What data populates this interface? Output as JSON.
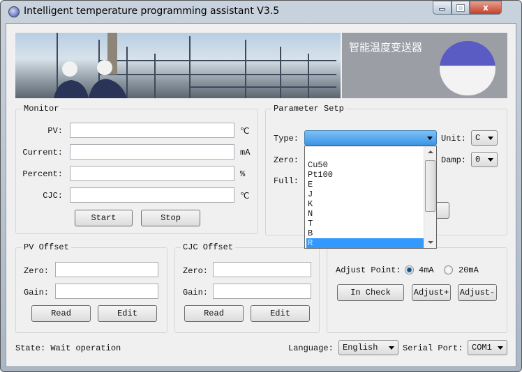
{
  "window": {
    "title": "Intelligent temperature programming assistant V3.5"
  },
  "banner": {
    "chinese_text": "智能温度变送器"
  },
  "monitor": {
    "title": "Monitor",
    "fields": [
      {
        "label": "PV:",
        "value": "",
        "unit": "℃"
      },
      {
        "label": "Current:",
        "value": "",
        "unit": "mA"
      },
      {
        "label": "Percent:",
        "value": "",
        "unit": "%"
      },
      {
        "label": "CJC:",
        "value": "",
        "unit": "℃"
      }
    ],
    "start": "Start",
    "stop": "Stop"
  },
  "parameter": {
    "title": "Parameter Setp",
    "type_label": "Type:",
    "type_value": "",
    "unit_label": "Unit:",
    "unit_value": "C",
    "zero_label": "Zero:",
    "damp_label": "Damp:",
    "damp_value": "0",
    "full_label": "Full:",
    "type_options": [
      "",
      "Cu50",
      "Pt100",
      "E",
      "J",
      "K",
      "N",
      "T",
      "B",
      "R"
    ],
    "selected_option": "R"
  },
  "pv_offset": {
    "title": "PV Offset",
    "zero_label": "Zero:",
    "gain_label": "Gain:",
    "zero": "",
    "gain": "",
    "read": "Read",
    "edit": "Edit"
  },
  "cjc_offset": {
    "title": "CJC Offset",
    "zero_label": "Zero:",
    "gain_label": "Gain:",
    "zero": "",
    "gain": "",
    "read": "Read",
    "edit": "Edit"
  },
  "zero_setup": {
    "adjust_point_label": "Adjust Point:",
    "options": [
      "4mA",
      "20mA"
    ],
    "selected": "4mA",
    "in_check": "In Check",
    "adjust_plus": "Adjust+",
    "adjust_minus": "Adjust-"
  },
  "status": {
    "state": "State: Wait operation",
    "language_label": "Language:",
    "language": "English",
    "serial_label": "Serial Port:",
    "serial": "COM1"
  }
}
